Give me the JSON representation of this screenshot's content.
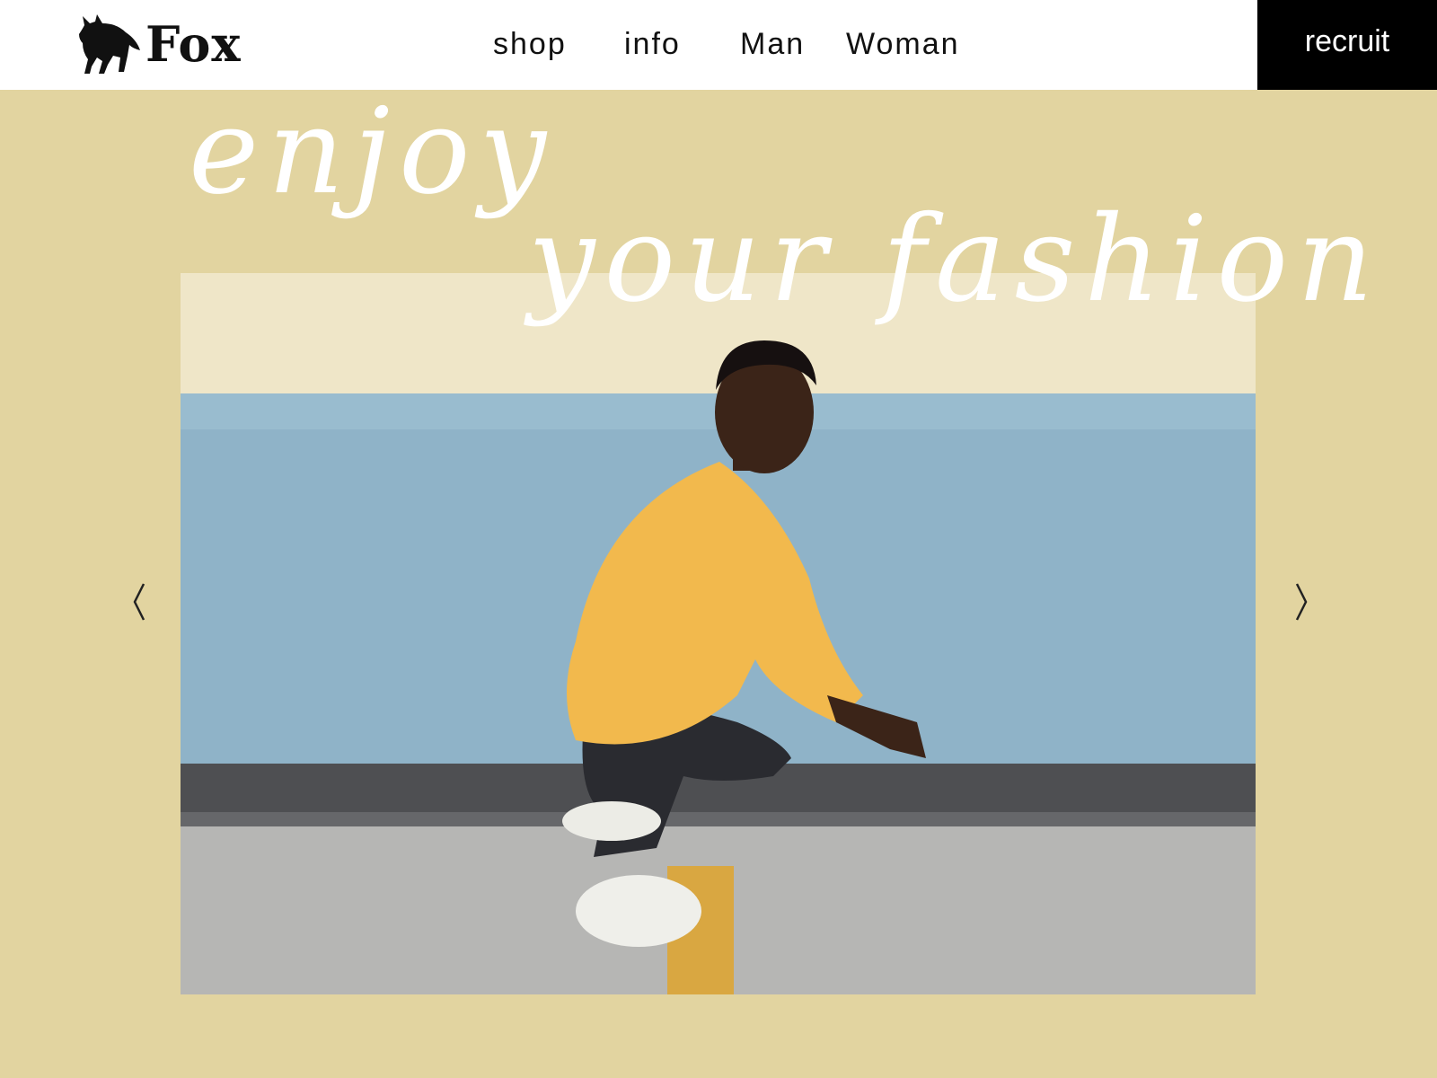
{
  "header": {
    "logo_text": "Fox",
    "logo_icon": "fox-icon",
    "nav": [
      {
        "label": "shop"
      },
      {
        "label": "info"
      },
      {
        "label": "Man"
      },
      {
        "label": "Woman"
      }
    ],
    "recruit_label": "recruit"
  },
  "hero": {
    "tagline_line1": "enjoy",
    "tagline_line2": "your fashion",
    "prev_icon": "chevron-left-icon",
    "next_icon": "chevron-right-icon"
  },
  "colors": {
    "background": "#e2d4a0",
    "header_bg": "#ffffff",
    "recruit_bg": "#000000",
    "tagline": "#ffffff"
  }
}
